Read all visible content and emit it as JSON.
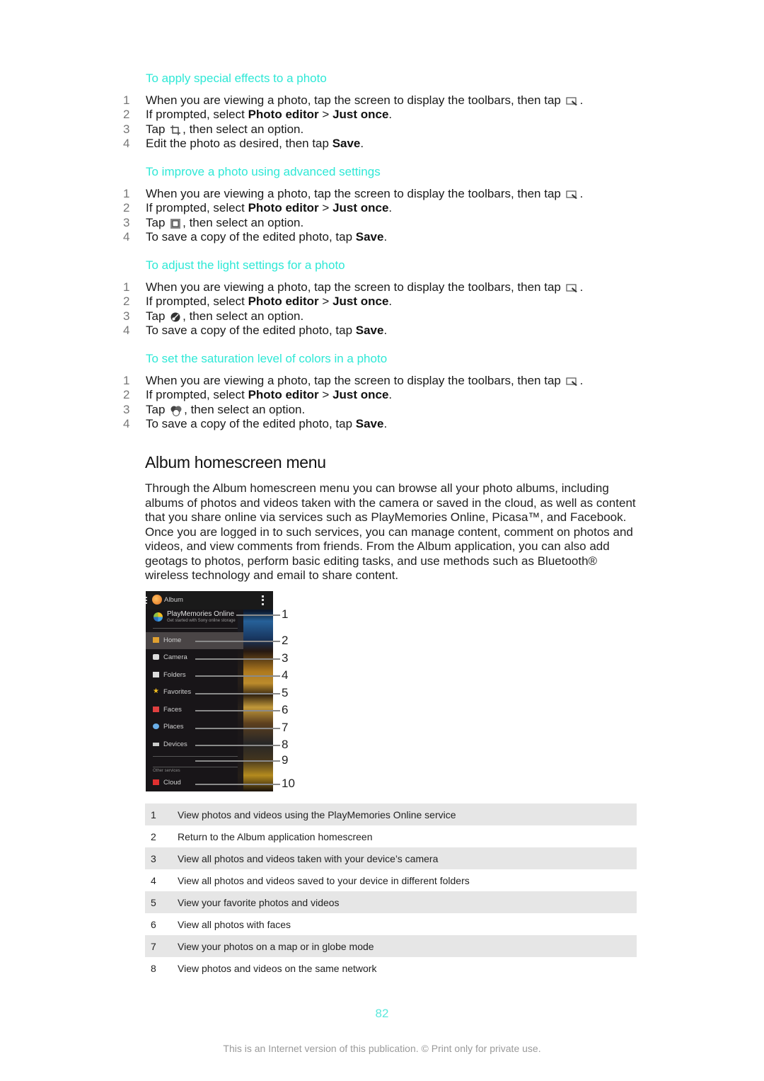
{
  "sections": [
    {
      "heading": "To apply special effects to a photo",
      "steps": [
        {
          "num": "1",
          "pre": "When you are viewing a photo, tap the screen to display the toolbars, then tap ",
          "icon": "photo-edit-icon",
          "post": "."
        },
        {
          "num": "2",
          "pre": "If prompted, select ",
          "b1": "Photo editor",
          "mid": " > ",
          "b2": "Just once",
          "post": "."
        },
        {
          "num": "3",
          "pre": "Tap ",
          "icon": "crop-icon",
          "post": ", then select an option."
        },
        {
          "num": "4",
          "pre": "Edit the photo as desired, then tap ",
          "b1": "Save",
          "post": "."
        }
      ]
    },
    {
      "heading": "To improve a photo using advanced settings",
      "steps": [
        {
          "num": "1",
          "pre": "When you are viewing a photo, tap the screen to display the toolbars, then tap ",
          "icon": "photo-edit-icon",
          "post": "."
        },
        {
          "num": "2",
          "pre": "If prompted, select ",
          "b1": "Photo editor",
          "mid": " > ",
          "b2": "Just once",
          "post": "."
        },
        {
          "num": "3",
          "pre": "Tap ",
          "icon": "frame-icon",
          "post": ", then select an option."
        },
        {
          "num": "4",
          "pre": "To save a copy of the edited photo, tap ",
          "b1": "Save",
          "post": "."
        }
      ]
    },
    {
      "heading": "To adjust the light settings for a photo",
      "steps": [
        {
          "num": "1",
          "pre": "When you are viewing a photo, tap the screen to display the toolbars, then tap ",
          "icon": "photo-edit-icon",
          "post": "."
        },
        {
          "num": "2",
          "pre": "If prompted, select ",
          "b1": "Photo editor",
          "mid": " > ",
          "b2": "Just once",
          "post": "."
        },
        {
          "num": "3",
          "pre": "Tap ",
          "icon": "light-icon",
          "post": ", then select an option."
        },
        {
          "num": "4",
          "pre": "To save a copy of the edited photo, tap ",
          "b1": "Save",
          "post": "."
        }
      ]
    },
    {
      "heading": "To set the saturation level of colors in a photo",
      "steps": [
        {
          "num": "1",
          "pre": "When you are viewing a photo, tap the screen to display the toolbars, then tap ",
          "icon": "photo-edit-icon",
          "post": "."
        },
        {
          "num": "2",
          "pre": "If prompted, select ",
          "b1": "Photo editor",
          "mid": " > ",
          "b2": "Just once",
          "post": "."
        },
        {
          "num": "3",
          "pre": "Tap ",
          "icon": "saturation-icon",
          "post": ", then select an option."
        },
        {
          "num": "4",
          "pre": "To save a copy of the edited photo, tap ",
          "b1": "Save",
          "post": "."
        }
      ]
    }
  ],
  "album": {
    "title": "Album homescreen menu",
    "paragraph": "Through the Album homescreen menu you can browse all your photo albums, including albums of photos and videos taken with the camera or saved in the cloud, as well as content that you share online via services such as PlayMemories Online, Picasa™, and Facebook. Once you are logged in to such services, you can manage content, comment on photos and videos, and view comments from friends. From the Album application, you can also add geotags to photos, perform basic editing tasks, and use methods such as Bluetooth® wireless technology and email to share content.",
    "screenshot": {
      "app_title": "Album",
      "playmemories_title": "PlayMemories Online",
      "playmemories_sub": "Get started with Sony online storage",
      "menu_items": [
        "Home",
        "Camera",
        "Folders",
        "Favorites",
        "Faces",
        "Places",
        "Devices"
      ],
      "other_services_label": "Other services",
      "cloud_label": "Cloud",
      "callouts": [
        "1",
        "2",
        "3",
        "4",
        "5",
        "6",
        "7",
        "8",
        "9",
        "10"
      ]
    },
    "legend": [
      {
        "num": "1",
        "text": "View photos and videos using the PlayMemories Online service"
      },
      {
        "num": "2",
        "text": "Return to the Album application homescreen"
      },
      {
        "num": "3",
        "text": "View all photos and videos taken with your device’s camera"
      },
      {
        "num": "4",
        "text": "View all photos and videos saved to your device in different folders"
      },
      {
        "num": "5",
        "text": "View your favorite photos and videos"
      },
      {
        "num": "6",
        "text": "View all photos with faces"
      },
      {
        "num": "7",
        "text": "View your photos on a map or in globe mode"
      },
      {
        "num": "8",
        "text": "View photos and videos on the same network"
      }
    ]
  },
  "page_number": "82",
  "footer": "This is an Internet version of this publication. © Print only for private use.",
  "colors": {
    "heading_accent": "#2ee8d6",
    "page_number": "#5be8dc",
    "legend_stripe": "#e6e6e6"
  }
}
